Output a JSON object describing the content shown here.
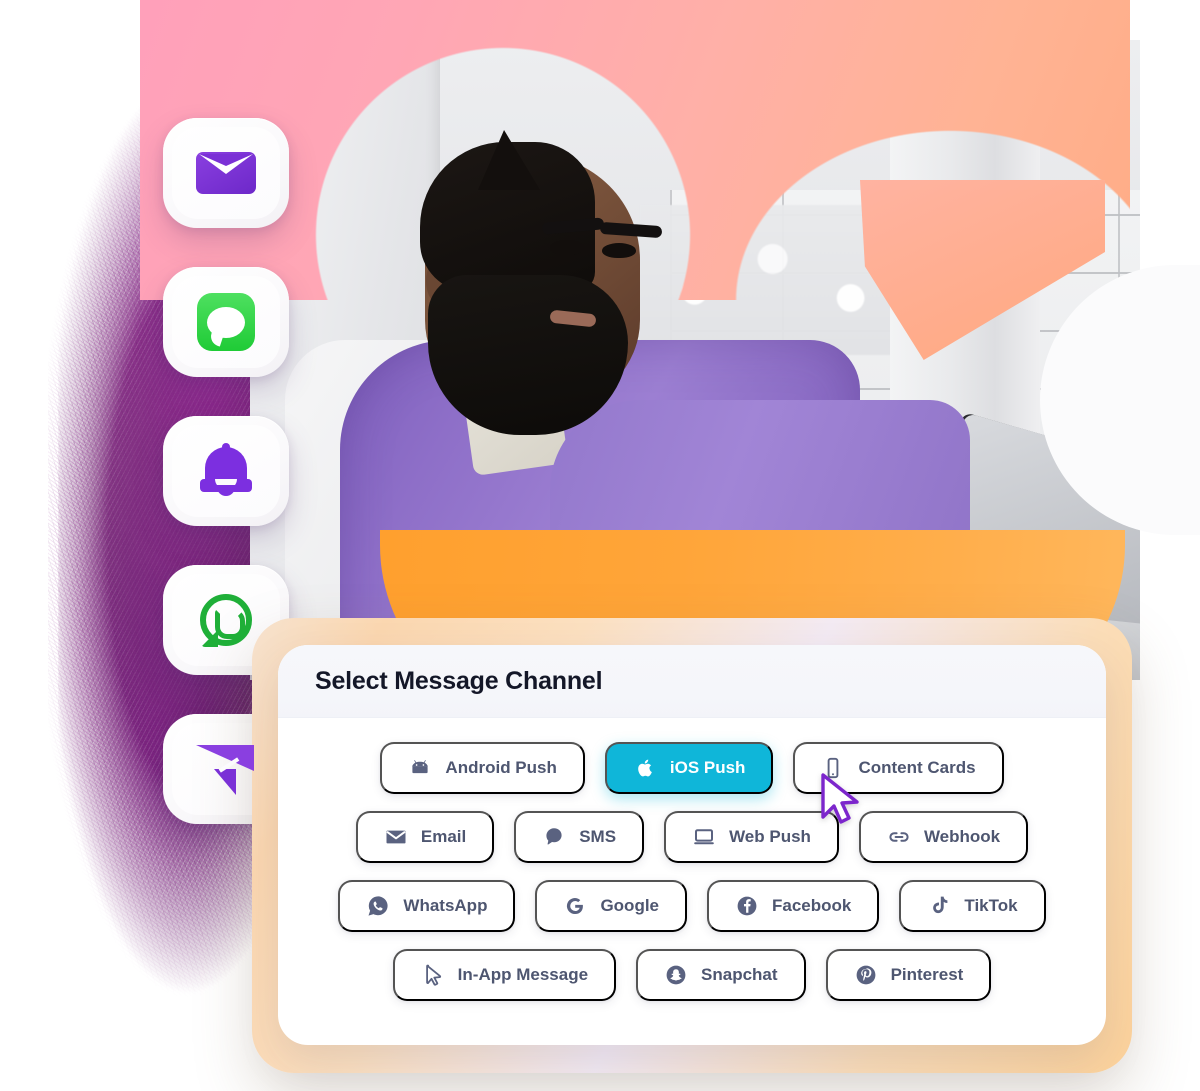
{
  "card": {
    "title": "Select Message Channel",
    "active_channel": "iOS Push",
    "accent_color": "#0FB6D9",
    "rows": [
      [
        {
          "label": "Android Push",
          "icon": "android-icon",
          "active": false
        },
        {
          "label": "iOS Push",
          "icon": "apple-icon",
          "active": true
        },
        {
          "label": "Content Cards",
          "icon": "mobile-phone-icon",
          "active": false
        }
      ],
      [
        {
          "label": "Email",
          "icon": "envelope-icon",
          "active": false
        },
        {
          "label": "SMS",
          "icon": "chat-bubble-icon",
          "active": false
        },
        {
          "label": "Web Push",
          "icon": "laptop-icon",
          "active": false
        },
        {
          "label": "Webhook",
          "icon": "link-chain-icon",
          "active": false
        }
      ],
      [
        {
          "label": "WhatsApp",
          "icon": "whatsapp-icon",
          "active": false
        },
        {
          "label": "Google",
          "icon": "google-g-icon",
          "active": false
        },
        {
          "label": "Facebook",
          "icon": "facebook-icon",
          "active": false
        },
        {
          "label": "TikTok",
          "icon": "tiktok-icon",
          "active": false
        }
      ],
      [
        {
          "label": "In-App Message",
          "icon": "cursor-arrow-icon",
          "active": false
        },
        {
          "label": "Snapchat",
          "icon": "snapchat-icon",
          "active": false
        },
        {
          "label": "Pinterest",
          "icon": "pinterest-icon",
          "active": false
        }
      ]
    ]
  },
  "app_icons": [
    {
      "name": "mail-app-icon",
      "color": "#7B31D6"
    },
    {
      "name": "imessage-app-icon",
      "color": "#2ECC4A"
    },
    {
      "name": "push-notification-bell-icon",
      "color": "#7C2FE0"
    },
    {
      "name": "whatsapp-app-icon",
      "color": "#1FAF38"
    },
    {
      "name": "send-message-icon",
      "color": "#8A3FE0"
    }
  ],
  "cursor": {
    "name": "mouse-pointer",
    "color": "#7C26CC"
  }
}
